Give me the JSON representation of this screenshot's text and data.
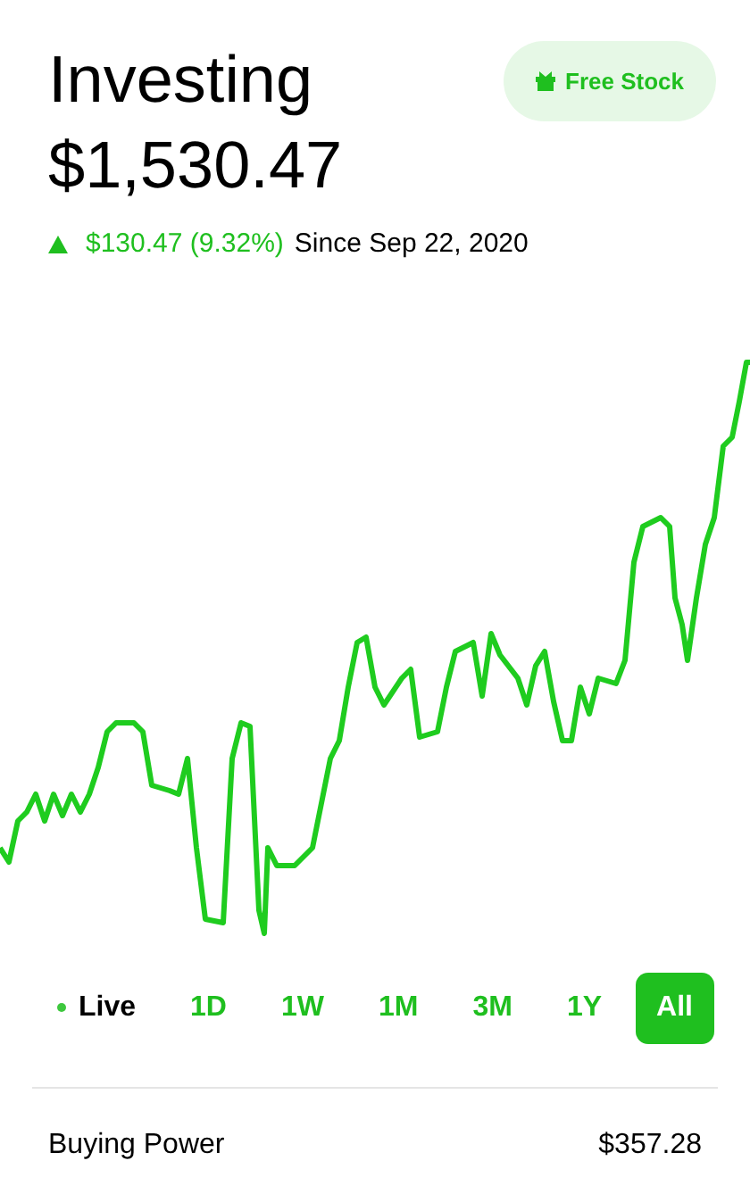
{
  "header": {
    "title": "Investing",
    "balance": "$1,530.47",
    "free_stock_button": "Free Stock"
  },
  "change": {
    "positive": true,
    "amount": "$130.47 (9.32%)",
    "since": "Since Sep 22, 2020"
  },
  "ranges": [
    {
      "label": "Live",
      "kind": "live",
      "selected": false
    },
    {
      "label": "1D",
      "kind": "period",
      "selected": false
    },
    {
      "label": "1W",
      "kind": "period",
      "selected": false
    },
    {
      "label": "1M",
      "kind": "period",
      "selected": false
    },
    {
      "label": "3M",
      "kind": "period",
      "selected": false
    },
    {
      "label": "1Y",
      "kind": "period",
      "selected": false
    },
    {
      "label": "All",
      "kind": "period",
      "selected": true
    }
  ],
  "buying_power": {
    "label": "Buying Power",
    "value": "$357.28"
  }
}
